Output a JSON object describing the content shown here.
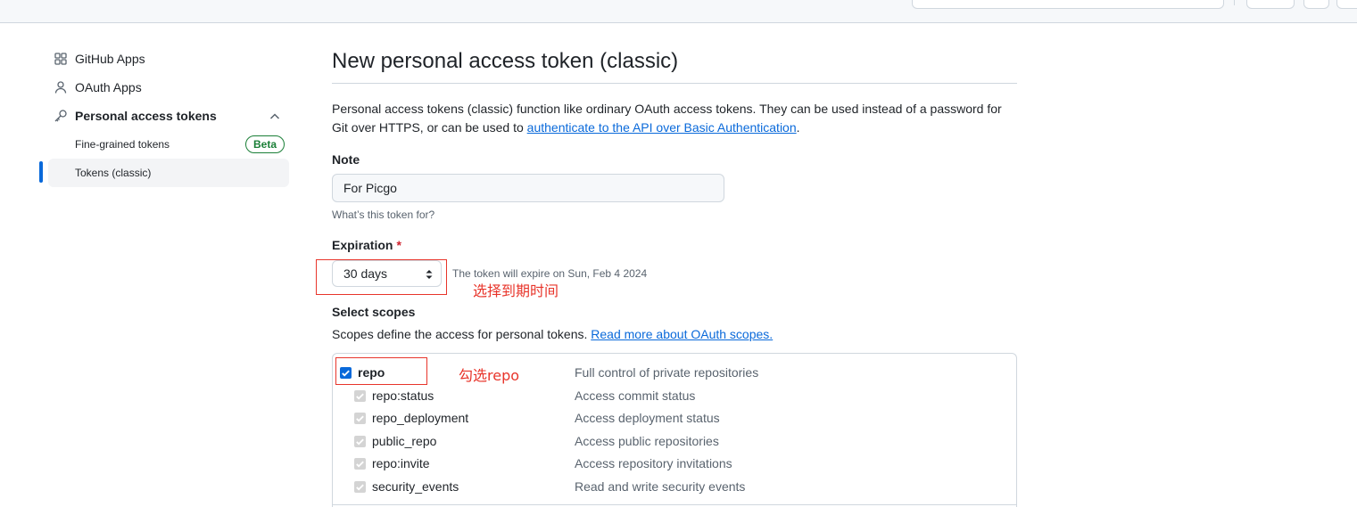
{
  "sidebar": {
    "github_apps": "GitHub Apps",
    "oauth_apps": "OAuth Apps",
    "personal_access_tokens": "Personal access tokens",
    "fine_grained_tokens": "Fine-grained tokens",
    "beta_badge": "Beta",
    "tokens_classic": "Tokens (classic)"
  },
  "main": {
    "title": "New personal access token (classic)",
    "description_prefix": "Personal access tokens (classic) function like ordinary OAuth access tokens. They can be used instead of a password for Git over HTTPS, or can be used to ",
    "description_link": "authenticate to the API over Basic Authentication",
    "description_suffix": ".",
    "note_label": "Note",
    "note_value": "For Picgo",
    "note_hint": "What’s this token for?",
    "expiration_label": "Expiration",
    "expiration_required": "*",
    "expiration_value": "30 days",
    "expiration_hint": "The token will expire on Sun, Feb 4 2024",
    "select_scopes_label": "Select scopes",
    "scopes_intro": "Scopes define the access for personal tokens. ",
    "scopes_link": "Read more about OAuth scopes."
  },
  "scopes": [
    {
      "name": "repo",
      "description": "Full control of private repositories",
      "checked": true,
      "child": false
    },
    {
      "name": "repo:status",
      "description": "Access commit status",
      "checked": true,
      "child": true
    },
    {
      "name": "repo_deployment",
      "description": "Access deployment status",
      "checked": true,
      "child": true
    },
    {
      "name": "public_repo",
      "description": "Access public repositories",
      "checked": true,
      "child": true
    },
    {
      "name": "repo:invite",
      "description": "Access repository invitations",
      "checked": true,
      "child": true
    },
    {
      "name": "security_events",
      "description": "Read and write security events",
      "checked": true,
      "child": true
    }
  ],
  "annotations": {
    "expiration": "选择到期时间",
    "repo": "勾选repo"
  },
  "colors": {
    "link": "#0969da",
    "annotation": "#e8352b",
    "beta": "#1a7f37",
    "checkbox": "#0969da"
  }
}
